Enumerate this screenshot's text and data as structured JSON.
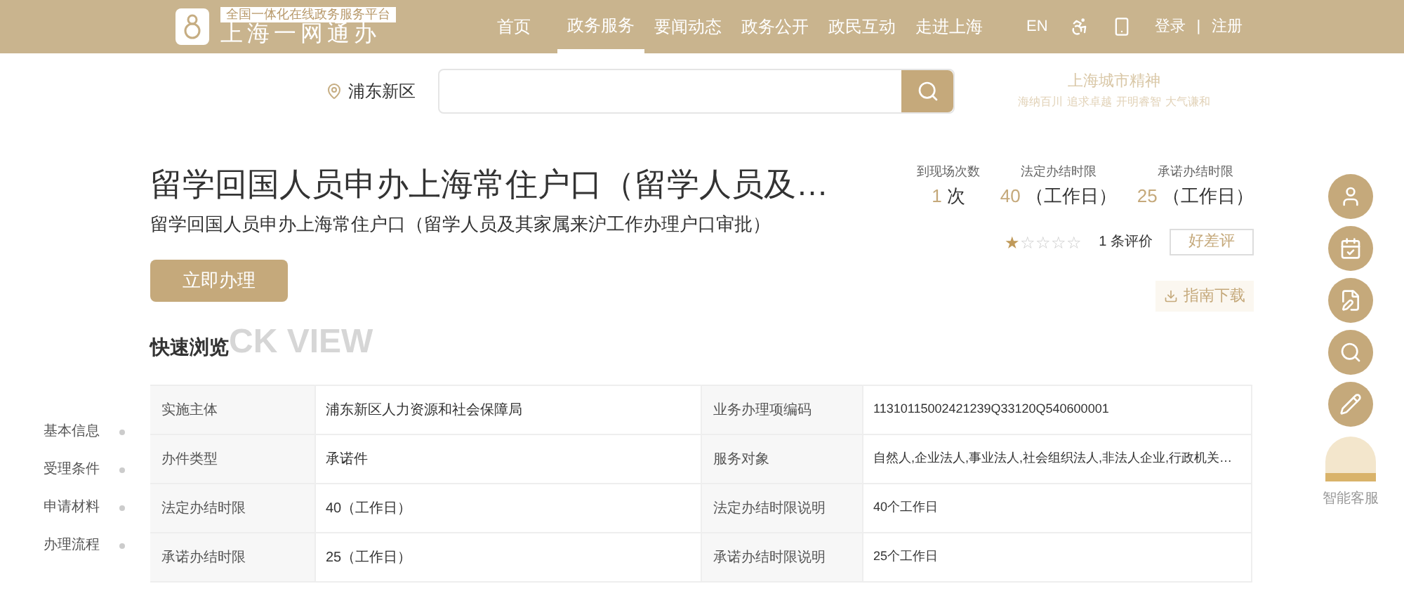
{
  "header": {
    "logo_subtitle": "全国一体化在线政务服务平台",
    "logo_title": "上海一网通办",
    "nav": [
      {
        "label": "首页",
        "selected": false
      },
      {
        "label": "政务服务",
        "selected": true
      },
      {
        "label": "要闻动态",
        "selected": false
      },
      {
        "label": "政务公开",
        "selected": false
      },
      {
        "label": "政民互动",
        "selected": false
      },
      {
        "label": "走进上海",
        "selected": false
      }
    ],
    "language": "EN",
    "login": "登录",
    "separator": "|",
    "register": "注册"
  },
  "search": {
    "location": "浦东新区"
  },
  "slogan": {
    "title": "上海城市精神",
    "words": [
      "海纳百川",
      "追求卓越",
      "开明睿智",
      "大气谦和"
    ]
  },
  "service": {
    "title": "留学回国人员申办上海常住户口（留学人员及…",
    "subtitle": "留学回国人员申办上海常住户口（留学人员及其家属来沪工作办理户口审批）",
    "apply_button": "立即办理",
    "stats": [
      {
        "label": "到现场次数",
        "number": "1",
        "unit": "次"
      },
      {
        "label": "法定办结时限",
        "number": "40",
        "unit": "（工作日）"
      },
      {
        "label": "承诺办结时限",
        "number": "25",
        "unit": "（工作日）"
      }
    ],
    "rating": {
      "stars": 1,
      "count": "1 条评价",
      "button": "好差评"
    },
    "guide_button": "指南下载"
  },
  "quick_view": {
    "title": "快速浏览",
    "watermark": "CK VIEW",
    "side_nav": [
      "基本信息",
      "受理条件",
      "申请材料",
      "办理流程"
    ],
    "rows": [
      {
        "cells": [
          {
            "label": "实施主体",
            "value": "浦东新区人力资源和社会保障局"
          },
          {
            "label": "业务办理项编码",
            "value": "11310115002421239Q33120Q540600001"
          }
        ]
      },
      {
        "cells": [
          {
            "label": "办件类型",
            "value": "承诺件"
          },
          {
            "label": "服务对象",
            "value": "自然人,企业法人,事业法人,社会组织法人,非法人企业,行政机关…"
          }
        ]
      },
      {
        "cells": [
          {
            "label": "法定办结时限",
            "value": "40（工作日）"
          },
          {
            "label": "法定办结时限说明",
            "value": "40个工作日"
          }
        ]
      },
      {
        "cells": [
          {
            "label": "承诺办结时限",
            "value": "25（工作日）"
          },
          {
            "label": "承诺办结时限说明",
            "value": "25个工作日"
          }
        ]
      }
    ]
  },
  "assistant": {
    "label": "智能客服"
  }
}
